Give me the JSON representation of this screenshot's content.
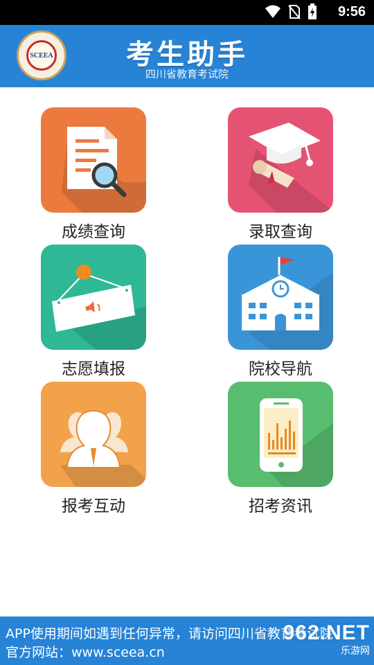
{
  "status_bar": {
    "time": "9:56"
  },
  "header": {
    "title": "考生助手",
    "subtitle": "四川省教育考试院",
    "logo_text": "SCEEA"
  },
  "tiles": [
    {
      "label": "成绩查询",
      "color": "#ec7a3f",
      "icon": "document-search-icon"
    },
    {
      "label": "录取查询",
      "color": "#e55372",
      "icon": "graduation-cap-icon"
    },
    {
      "label": "志愿填报",
      "color": "#2eb896",
      "icon": "hanging-sign-icon"
    },
    {
      "label": "院校导航",
      "color": "#3a95d8",
      "icon": "school-building-icon"
    },
    {
      "label": "报考互动",
      "color": "#f2a24a",
      "icon": "people-group-icon"
    },
    {
      "label": "招考资讯",
      "color": "#58bd6f",
      "icon": "phone-chart-icon"
    }
  ],
  "footer": {
    "line1": "APP使用期间如遇到任何异常，请访问四川省教育考试院",
    "line2": "官方网站：www.sceea.cn"
  },
  "watermark": {
    "brand": "962.NET",
    "sub": "乐游网"
  }
}
